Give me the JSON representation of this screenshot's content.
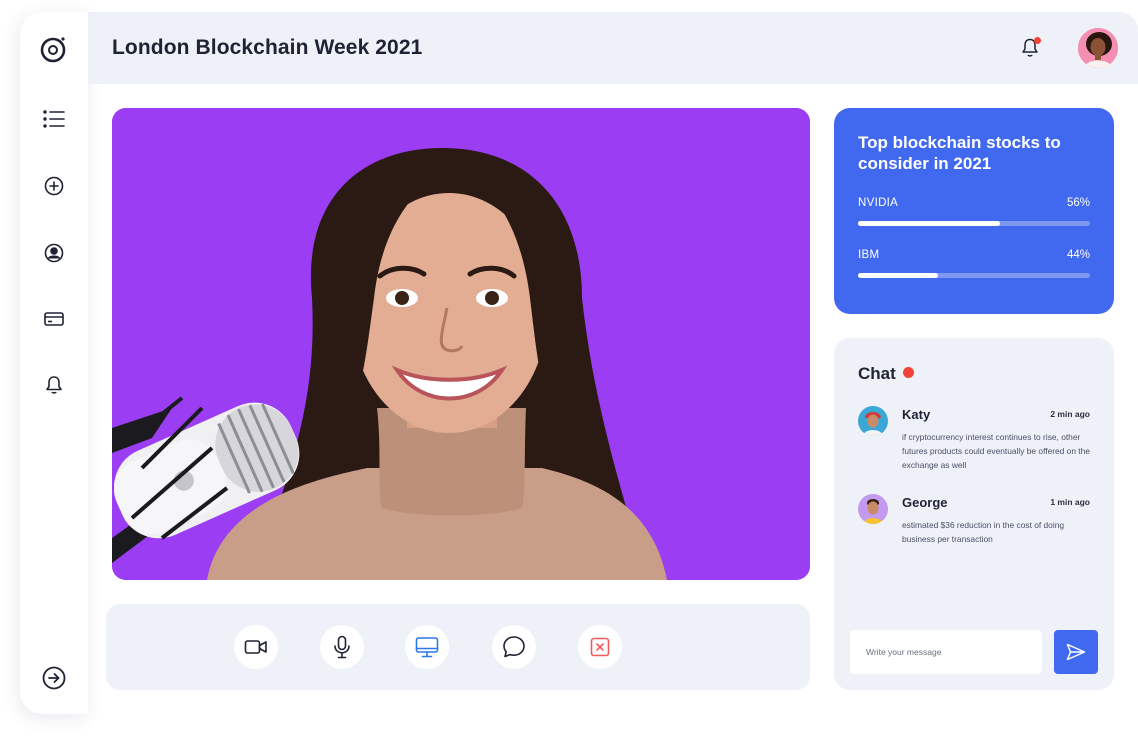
{
  "header": {
    "title": "London Blockchain Week 2021",
    "notification_icon": "bell-icon",
    "avatar_icon": "user-avatar"
  },
  "sidebar": {
    "items": [
      {
        "icon": "logo-icon"
      },
      {
        "icon": "list-icon"
      },
      {
        "icon": "plus-circle-icon"
      },
      {
        "icon": "user-circle-icon"
      },
      {
        "icon": "credit-card-icon"
      },
      {
        "icon": "bell-icon"
      },
      {
        "icon": "logout-icon"
      }
    ]
  },
  "controls": [
    {
      "icon": "video-camera-icon"
    },
    {
      "icon": "microphone-icon"
    },
    {
      "icon": "screen-share-icon",
      "active": true
    },
    {
      "icon": "chat-bubble-icon"
    },
    {
      "icon": "end-call-icon"
    }
  ],
  "stocks": {
    "title": "Top blockchain stocks to consider in 2021",
    "items": [
      {
        "name": "NVIDIA",
        "percent_label": "56%",
        "percent": 0.61
      },
      {
        "name": "IBM",
        "percent_label": "44%",
        "percent": 0.345
      }
    ]
  },
  "chat": {
    "title": "Chat",
    "messages": [
      {
        "name": "Katy",
        "time": "2 min ago",
        "text": "if cryptocurrency interest continues to rise, other futures products could eventually be offered on the exchange as well"
      },
      {
        "name": "George",
        "time": "1 min ago",
        "text": "estimated $36 reduction in the cost of doing business per transaction"
      }
    ],
    "input_placeholder": "Write your message",
    "send_icon": "send-icon"
  },
  "colors": {
    "accent": "#4169ef",
    "video_bg": "#9b3df2",
    "panel_bg": "#eff1f9",
    "alert": "#f04438"
  }
}
